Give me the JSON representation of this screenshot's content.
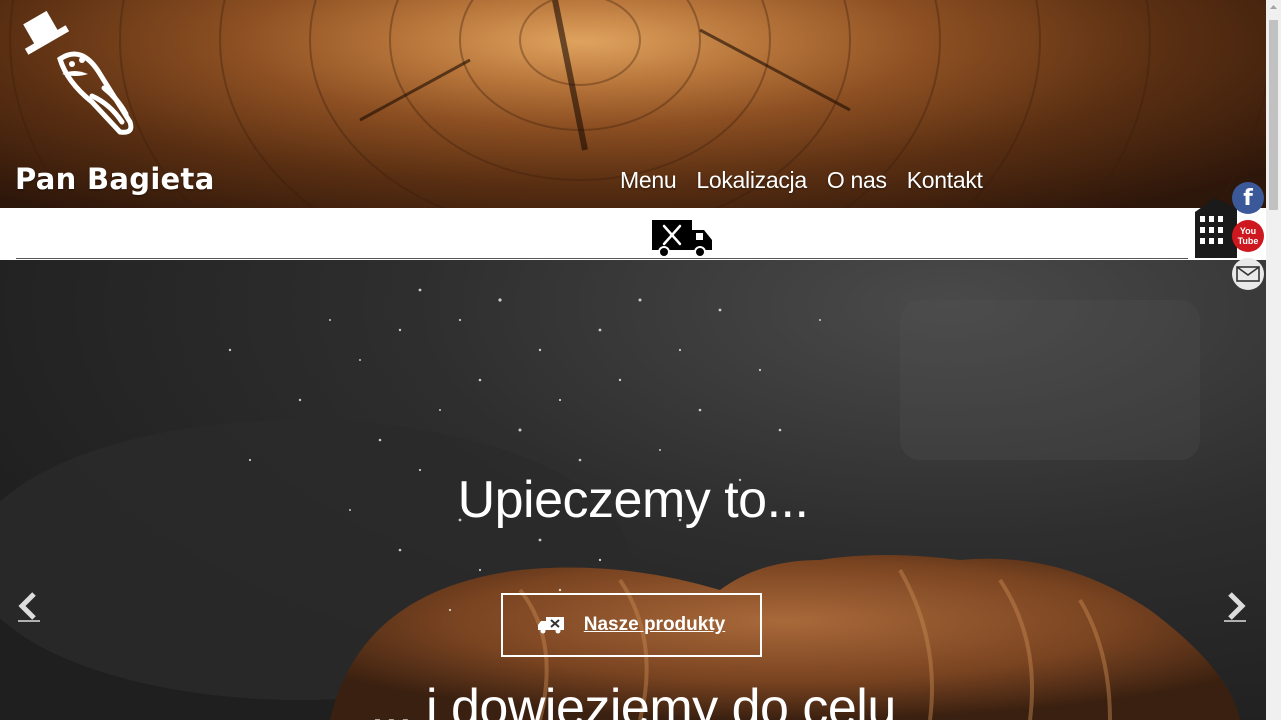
{
  "brand": {
    "name": "Pan Bagieta"
  },
  "nav": {
    "items": [
      "Menu",
      "Lokalizacja",
      "O nas",
      "Kontakt"
    ]
  },
  "hero": {
    "headline": "Upieczemy to...",
    "cta_label": "Nasze produkty",
    "subline": "... i dowieziemy do celu"
  },
  "social": {
    "facebook_glyph": "f",
    "youtube_top": "You",
    "youtube_bottom": "Tube"
  },
  "icons": [
    "logo-baguette-icon",
    "food-truck-icon",
    "truck-delivery-icon",
    "prev-arrow-icon",
    "next-arrow-icon",
    "building-icon",
    "facebook-icon",
    "youtube-icon",
    "email-icon"
  ],
  "colors": {
    "facebook": "#3b5998",
    "youtube": "#cc181e",
    "email": "#e9e9e9"
  }
}
